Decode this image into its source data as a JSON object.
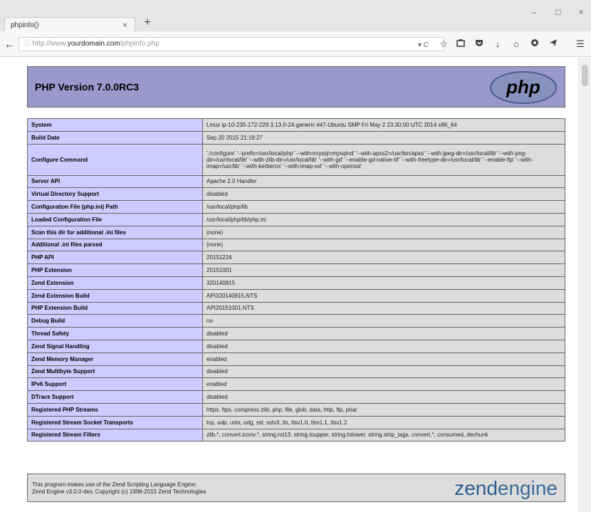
{
  "browser": {
    "tab_title": "phpinfo()",
    "tab_close": "×",
    "new_tab": "+",
    "win_min": "–",
    "win_max": "□",
    "win_close": "×",
    "url_prefix": "http://www.",
    "url_domain": "yourdomain.com",
    "url_path": "/phpinfo.php",
    "url_tools": "▾ C"
  },
  "page": {
    "title": "PHP Version 7.0.0RC3",
    "php_logo_text": "php",
    "rows": [
      {
        "name": "System",
        "value": "Linux ip-10-235-172-229 3.13.0-24-generic #47-Ubuntu SMP Fri May 2 23:30:00 UTC 2014 x86_64"
      },
      {
        "name": "Build Date",
        "value": "Sep 20 2015 21:19:27"
      },
      {
        "name": "Configure Command",
        "value": "'./configure' '--prefix=/usr/local/php' '--with=mysql=mysqlnd' '--with-apxs2=/usr/bin/apxs' '--with-jpeg-dir=/usr/local/lib' '--with-png-dir=/usr/local/lib' '--with-zlib-dir=/usr/local/lib' '--with-gd' '--enable-gd-native-ttf' '--with-freetype-dir=/usr/local/lib' '--enable-ftp' '--with-imap=/usr/lib' '--with-kerberos' '--with-imap-ssl' '--with-openssl'",
        "tall": true
      },
      {
        "name": "Server API",
        "value": "Apache 2.0 Handler"
      },
      {
        "name": "Virtual Directory Support",
        "value": "disabled"
      },
      {
        "name": "Configuration File (php.ini) Path",
        "value": "/usr/local/php/lib"
      },
      {
        "name": "Loaded Configuration File",
        "value": "/usr/local/php/lib/php.ini"
      },
      {
        "name": "Scan this dir for additional .ini files",
        "value": "(none)"
      },
      {
        "name": "Additional .ini files parsed",
        "value": "(none)"
      },
      {
        "name": "PHP API",
        "value": "20151216"
      },
      {
        "name": "PHP Extension",
        "value": "20151001"
      },
      {
        "name": "Zend Extension",
        "value": "320140815"
      },
      {
        "name": "Zend Extension Build",
        "value": "API320140815,NTS"
      },
      {
        "name": "PHP Extension Build",
        "value": "API20151001,NTS"
      },
      {
        "name": "Debug Build",
        "value": "no"
      },
      {
        "name": "Thread Safety",
        "value": "disabled"
      },
      {
        "name": "Zend Signal Handling",
        "value": "disabled"
      },
      {
        "name": "Zend Memory Manager",
        "value": "enabled"
      },
      {
        "name": "Zend Multibyte Support",
        "value": "disabled"
      },
      {
        "name": "IPv6 Support",
        "value": "enabled"
      },
      {
        "name": "DTrace Support",
        "value": "disabled"
      },
      {
        "name": "Registered PHP Streams",
        "value": "https, ftps, compress.zlib, php, file, glob, data, http, ftp, phar"
      },
      {
        "name": "Registered Stream Socket Transports",
        "value": "tcp, udp, unix, udg, ssl, sslv3, tls, tlsv1.0, tlsv1.1, tlsv1.2"
      },
      {
        "name": "Registered Stream Filters",
        "value": "zlib.*, convert.iconv.*, string.rot13, string.toupper, string.tolower, string.strip_tags, convert.*, consumed, dechunk"
      }
    ],
    "zend_line1": "This program makes use of the Zend Scripting Language Engine:",
    "zend_line2": "Zend Engine v3.0.0-dev, Copyright (c) 1998-2015 Zend Technologies",
    "zend_logo_text": "zend",
    "zend_logo_text2": "engine"
  },
  "icons": [
    "back-icon",
    "info-icon",
    "reload-icon",
    "bookmark-star-icon",
    "library-icon",
    "pocket-icon",
    "download-icon",
    "home-icon",
    "sync-icon",
    "send-icon",
    "menu-icon"
  ]
}
